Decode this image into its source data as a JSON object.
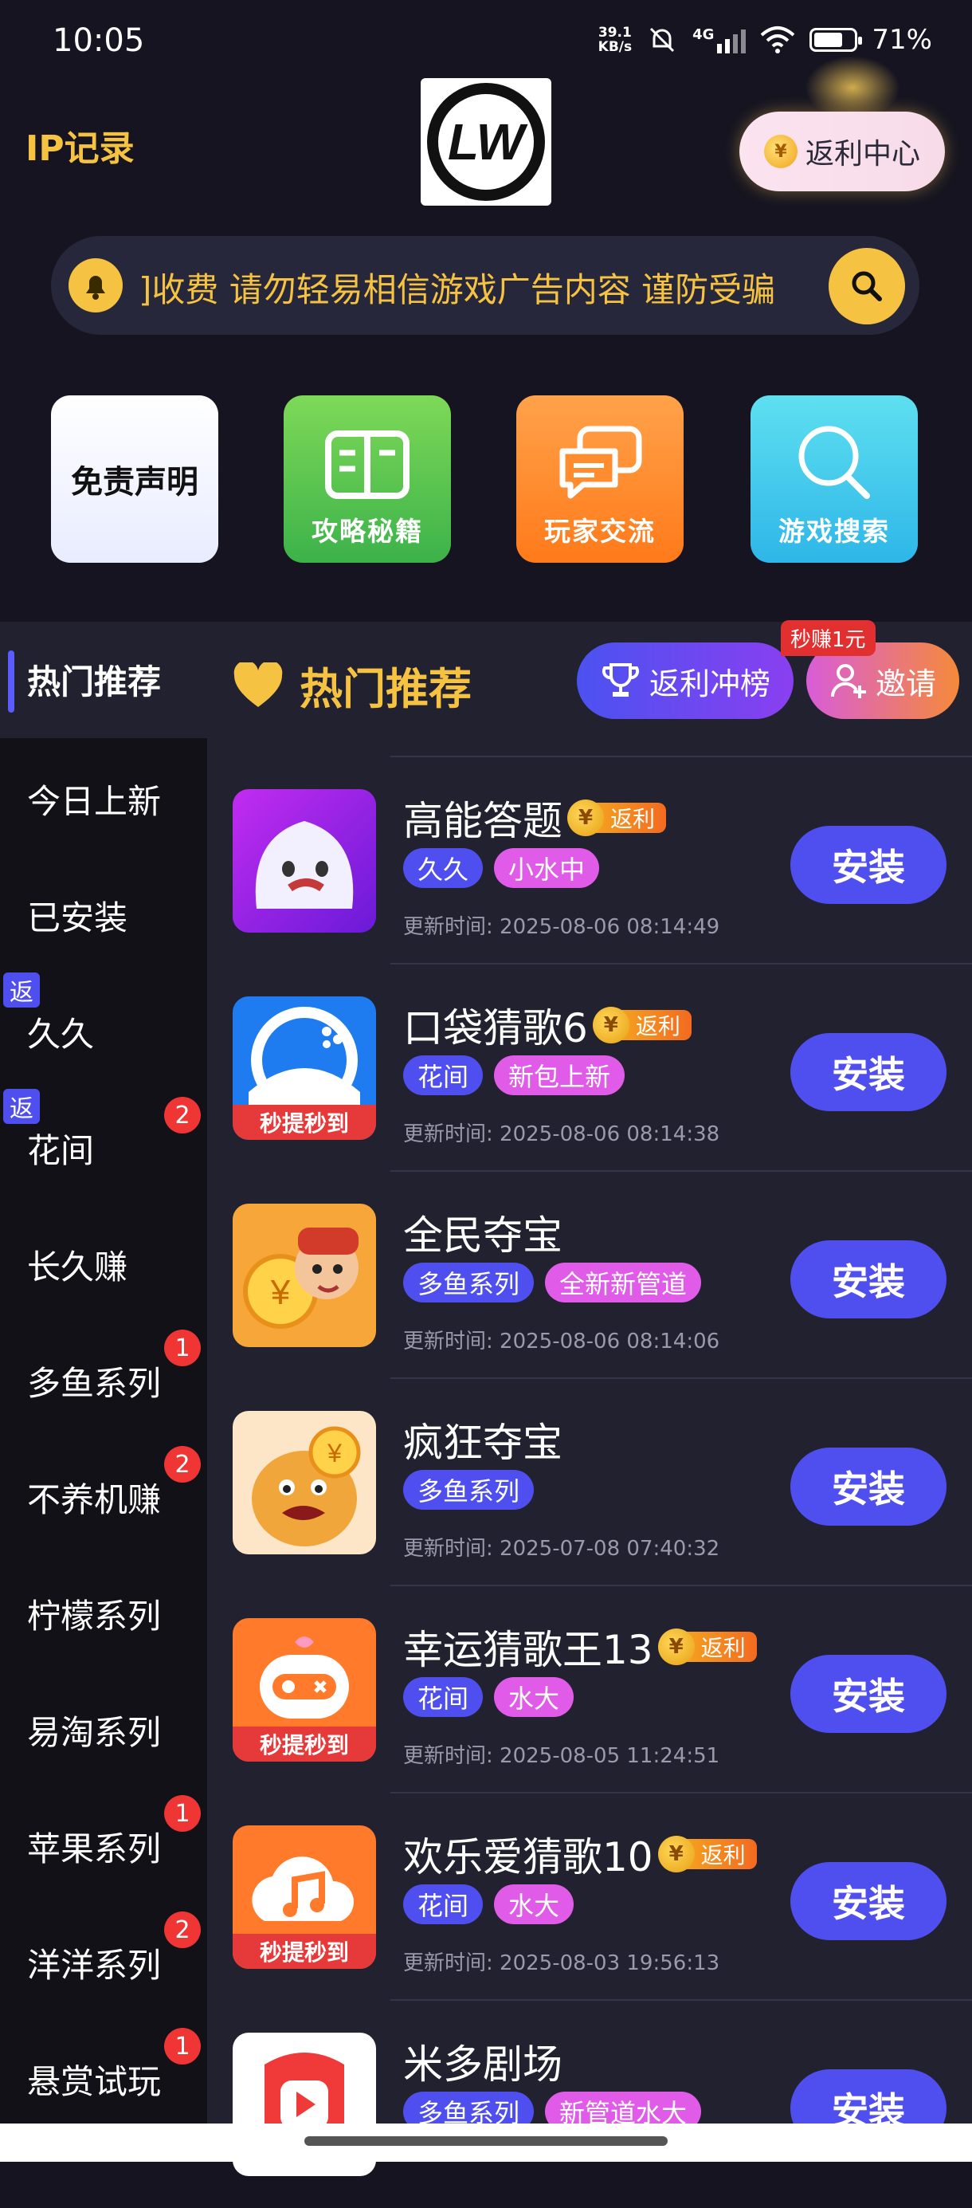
{
  "status": {
    "time": "10:05",
    "speed_top": "39.1",
    "speed_bottom": "KB/s",
    "network": "4G",
    "battery": "71%",
    "battery_level": 0.71
  },
  "header": {
    "title": "IP记录",
    "logo_text": "LW",
    "rebate_center": "返利中心"
  },
  "notice": {
    "text": "]收费 请勿轻易相信游戏广告内容 谨防受骗"
  },
  "shortcuts": [
    {
      "label": "免责声明"
    },
    {
      "label": "攻略秘籍",
      "icon": "book-icon"
    },
    {
      "label": "玩家交流",
      "icon": "chat-icon"
    },
    {
      "label": "游戏搜索",
      "icon": "search-icon"
    }
  ],
  "sidebar": {
    "active": "热门推荐",
    "items": [
      {
        "label": "今日上新"
      },
      {
        "label": "已安装"
      },
      {
        "label": "久久",
        "tag": "返"
      },
      {
        "label": "花间",
        "tag": "返",
        "badge": "2"
      },
      {
        "label": "长久赚"
      },
      {
        "label": "多鱼系列",
        "badge": "1"
      },
      {
        "label": "不养机赚",
        "badge": "2"
      },
      {
        "label": "柠檬系列"
      },
      {
        "label": "易淘系列"
      },
      {
        "label": "苹果系列",
        "badge": "1"
      },
      {
        "label": "洋洋系列",
        "badge": "2"
      },
      {
        "label": "悬赏试玩",
        "badge": "1"
      }
    ]
  },
  "section": {
    "title": "热门推荐",
    "rank_button": "返利冲榜",
    "invite_button": "邀请",
    "invite_tag": "秒赚1元"
  },
  "rebate_label": "返利",
  "coin_symbol": "¥",
  "install_label": "安装",
  "ribbon_label": "秒提秒到",
  "apps": [
    {
      "name": "高能答题",
      "rebate": true,
      "tags": [
        "久久",
        "小水中"
      ],
      "updated": "更新时间: 2025-08-06 08:14:49"
    },
    {
      "name": "口袋猜歌6",
      "rebate": true,
      "tags": [
        "花间",
        "新包上新"
      ],
      "updated": "更新时间: 2025-08-06 08:14:38"
    },
    {
      "name": "全民夺宝",
      "rebate": false,
      "tags": [
        "多鱼系列",
        "全新新管道"
      ],
      "updated": "更新时间: 2025-08-06 08:14:06"
    },
    {
      "name": "疯狂夺宝",
      "rebate": false,
      "tags": [
        "多鱼系列"
      ],
      "updated": "更新时间: 2025-07-08 07:40:32"
    },
    {
      "name": "幸运猜歌王13",
      "rebate": true,
      "tags": [
        "花间",
        "水大"
      ],
      "updated": "更新时间: 2025-08-05 11:24:51"
    },
    {
      "name": "欢乐爱猜歌10",
      "rebate": true,
      "tags": [
        "花间",
        "水大"
      ],
      "updated": "更新时间: 2025-08-03 19:56:13"
    },
    {
      "name": "米多剧场",
      "rebate": false,
      "tags": [
        "多鱼系列",
        "新管道水大"
      ],
      "updated": ""
    }
  ]
}
